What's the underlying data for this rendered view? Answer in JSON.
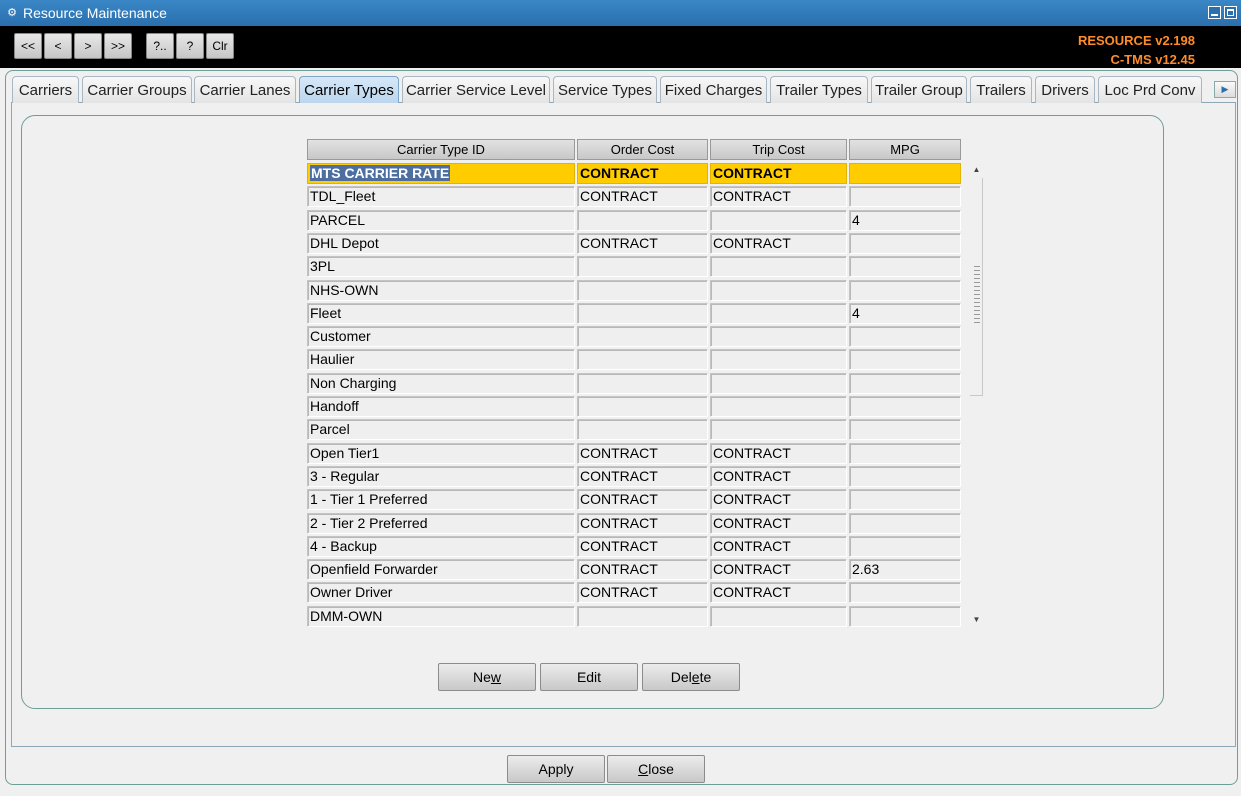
{
  "window": {
    "title": "Resource Maintenance",
    "app_icon": "app-icon"
  },
  "toolbar": {
    "nav_buttons": [
      "<<",
      "<",
      ">",
      ">>",
      "?..",
      "?",
      "Clr"
    ],
    "version_lines": [
      "RESOURCE v2.198",
      "C-TMS v12.45"
    ],
    "version_color": "#ff8c2a"
  },
  "tabs": {
    "items": [
      "Carriers",
      "Carrier Groups",
      "Carrier Lanes",
      "Carrier Types",
      "Carrier Service Level",
      "Service Types",
      "Fixed Charges",
      "Trailer Types",
      "Trailer Group",
      "Trailers",
      "Drivers",
      "Loc Prd Conv"
    ],
    "active": "Carrier Types"
  },
  "grid": {
    "columns": [
      "Carrier Type ID",
      "Order Cost",
      "Trip Cost",
      "MPG"
    ],
    "selected_row_index": 0,
    "selected_color": "#ffcc00",
    "rows": [
      [
        "MTS CARRIER RATE",
        "CONTRACT",
        "CONTRACT",
        ""
      ],
      [
        "TDL_Fleet",
        "CONTRACT",
        "CONTRACT",
        ""
      ],
      [
        "PARCEL",
        "",
        "",
        "4"
      ],
      [
        "DHL Depot",
        "CONTRACT",
        "CONTRACT",
        ""
      ],
      [
        "3PL",
        "",
        "",
        ""
      ],
      [
        "NHS-OWN",
        "",
        "",
        ""
      ],
      [
        "Fleet",
        "",
        "",
        "4"
      ],
      [
        "Customer",
        "",
        "",
        ""
      ],
      [
        "Haulier",
        "",
        "",
        ""
      ],
      [
        "Non Charging",
        "",
        "",
        ""
      ],
      [
        "Handoff",
        "",
        "",
        ""
      ],
      [
        "Parcel",
        "",
        "",
        ""
      ],
      [
        "Open Tier1",
        "CONTRACT",
        "CONTRACT",
        ""
      ],
      [
        "3 - Regular",
        "CONTRACT",
        "CONTRACT",
        ""
      ],
      [
        "1 - Tier 1 Preferred",
        "CONTRACT",
        "CONTRACT",
        ""
      ],
      [
        "2 - Tier 2 Preferred",
        "CONTRACT",
        "CONTRACT",
        ""
      ],
      [
        "4 - Backup",
        "CONTRACT",
        "CONTRACT",
        ""
      ],
      [
        "Openfield Forwarder",
        "CONTRACT",
        "CONTRACT",
        "2.63"
      ],
      [
        "Owner Driver",
        "CONTRACT",
        "CONTRACT",
        ""
      ],
      [
        "DMM-OWN",
        "",
        "",
        ""
      ]
    ]
  },
  "actions": {
    "new": {
      "before": "Ne",
      "ul": "w",
      "after": ""
    },
    "edit": {
      "before": "Edit",
      "ul": "",
      "after": ""
    },
    "delete": {
      "before": "Del",
      "ul": "e",
      "after": "te"
    }
  },
  "footer": {
    "apply": {
      "before": "Apply",
      "ul": "",
      "after": ""
    },
    "close": {
      "before": "",
      "ul": "C",
      "after": "lose"
    }
  }
}
